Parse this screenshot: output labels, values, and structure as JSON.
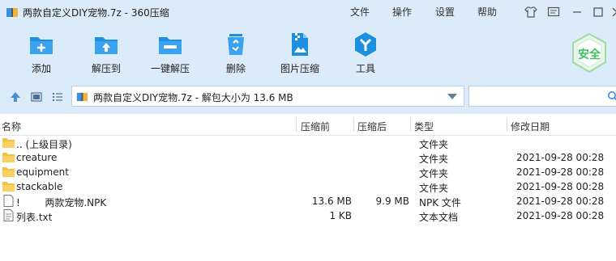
{
  "window": {
    "title": "两款自定义DIY宠物.7z - 360压缩"
  },
  "menu": [
    "文件",
    "操作",
    "设置",
    "帮助"
  ],
  "toolbar": {
    "items": [
      {
        "label": "添加",
        "icon": "add-folder-icon"
      },
      {
        "label": "解压到",
        "icon": "extract-to-icon"
      },
      {
        "label": "一键解压",
        "icon": "one-click-extract-icon"
      },
      {
        "label": "删除",
        "icon": "recycle-bin-icon"
      },
      {
        "label": "图片压缩",
        "icon": "image-compress-icon"
      },
      {
        "label": "工具",
        "icon": "tools-icon"
      }
    ],
    "safe_label": "安全"
  },
  "address": {
    "text": "两款自定义DIY宠物.7z - 解包大小为 13.6 MB"
  },
  "search": {
    "placeholder": ""
  },
  "columns": {
    "name": "名称",
    "size": "压缩前",
    "compressed": "压缩后",
    "type": "类型",
    "modified": "修改日期"
  },
  "files": [
    {
      "name": ".. (上级目录)",
      "size": "",
      "compressed": "",
      "type": "文件夹",
      "modified": "",
      "icon": "folder-icon"
    },
    {
      "name": "creature",
      "size": "",
      "compressed": "",
      "type": "文件夹",
      "modified": "2021-09-28 00:28",
      "icon": "folder-icon"
    },
    {
      "name": "equipment",
      "size": "",
      "compressed": "",
      "type": "文件夹",
      "modified": "2021-09-28 00:28",
      "icon": "folder-icon"
    },
    {
      "name": "stackable",
      "size": "",
      "compressed": "",
      "type": "文件夹",
      "modified": "2021-09-28 00:28",
      "icon": "folder-icon"
    },
    {
      "name": "!        两款宠物.NPK",
      "size": "13.6 MB",
      "compressed": "9.9 MB",
      "type": "NPK 文件",
      "modified": "2021-09-28 00:28",
      "icon": "file-icon"
    },
    {
      "name": "列表.txt",
      "size": "1 KB",
      "compressed": "",
      "type": "文本文档",
      "modified": "2021-09-28 00:28",
      "icon": "text-file-icon"
    }
  ],
  "colors": {
    "chrome": "#dcebfa",
    "accent": "#1d8fe0",
    "safe": "#3fbf60"
  }
}
